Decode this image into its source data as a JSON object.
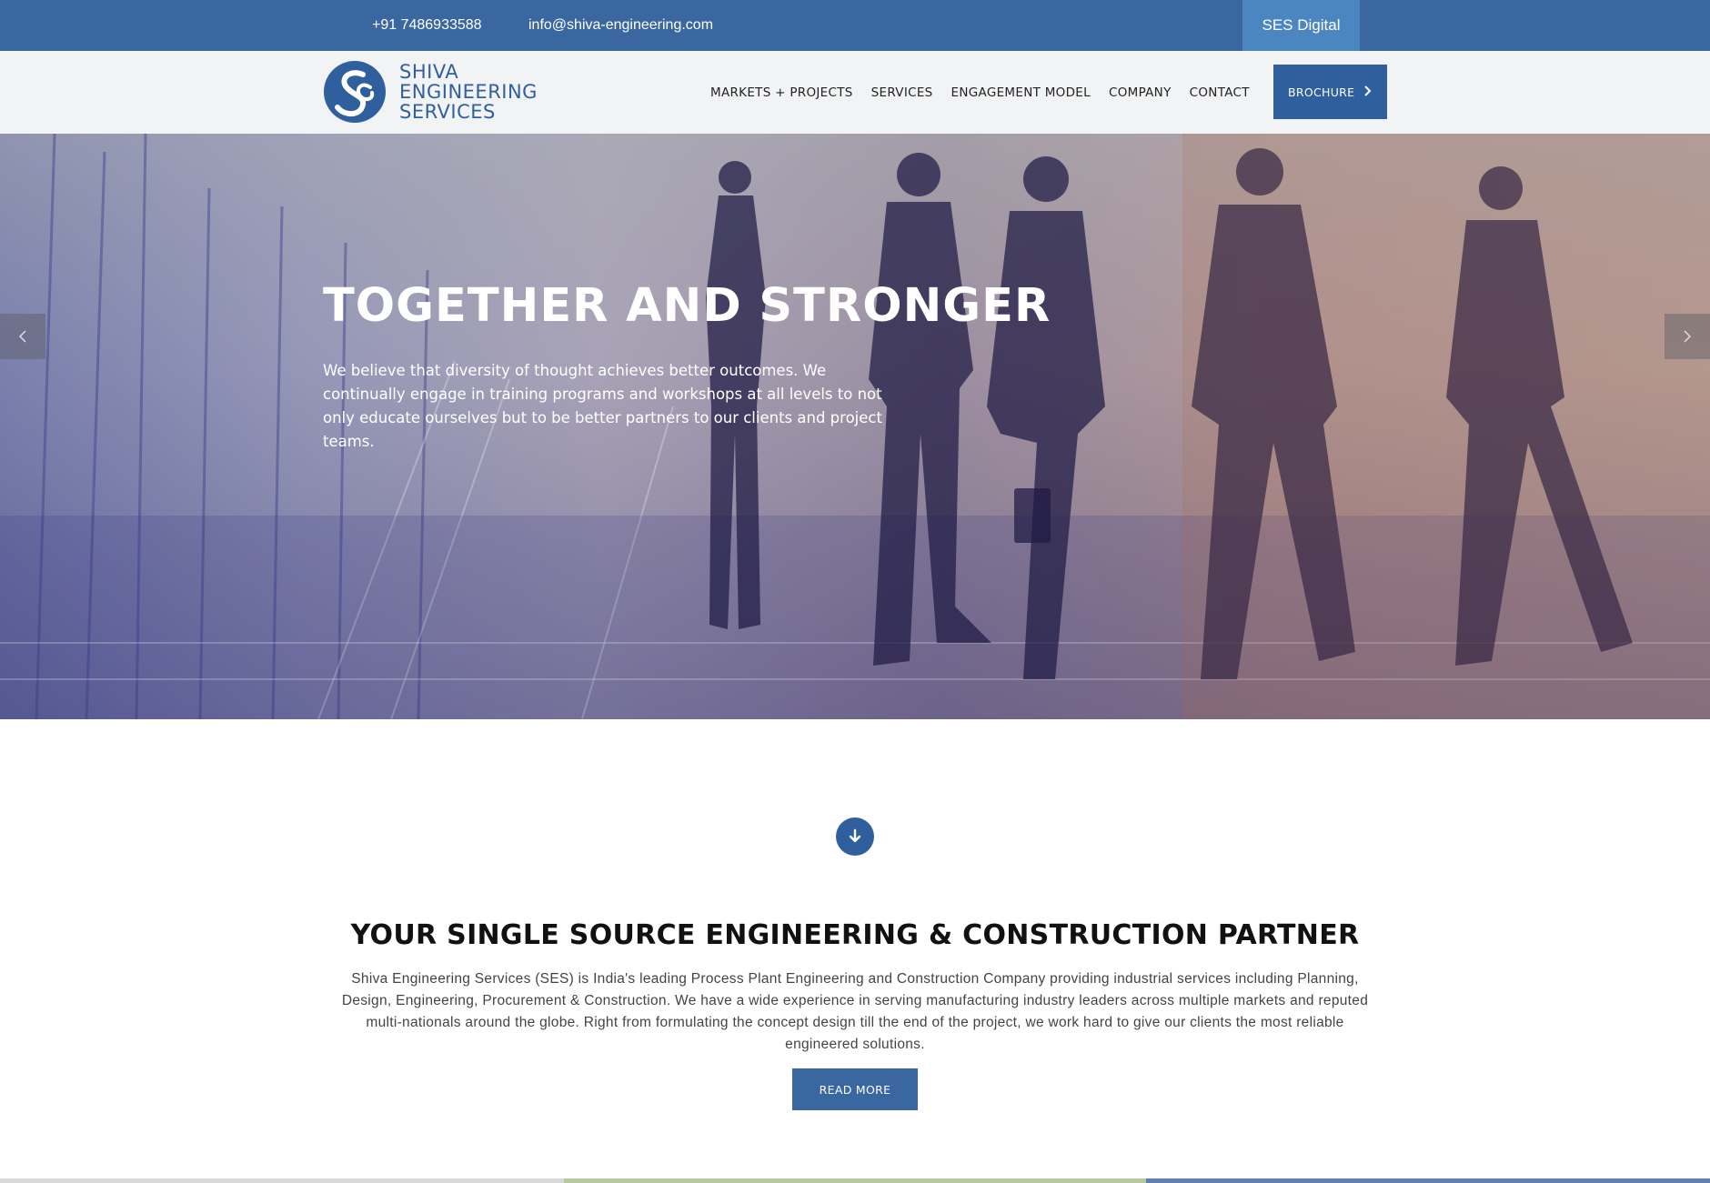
{
  "topbar": {
    "phone": "+91 7486933588",
    "email": "info@shiva-engineering.com",
    "digital_label": "SES Digital"
  },
  "brand": {
    "line1": "SHIVA",
    "line2": "ENGINEERING",
    "line3": "SERVICES"
  },
  "nav": {
    "items": [
      {
        "label": "MARKETS + PROJECTS"
      },
      {
        "label": "SERVICES"
      },
      {
        "label": "ENGAGEMENT MODEL"
      },
      {
        "label": "COMPANY"
      },
      {
        "label": "CONTACT"
      }
    ],
    "brochure_label": "BROCHURE"
  },
  "hero": {
    "title": "TOGETHER AND STRONGER",
    "text": "We believe that diversity of thought achieves better outcomes. We continually engage in training programs and workshops at all levels to not only educate ourselves but to be better partners to our clients and project teams."
  },
  "intro": {
    "title": "YOUR SINGLE SOURCE ENGINEERING & CONSTRUCTION PARTNER",
    "text": "Shiva Engineering Services (SES) is India's leading Process Plant Engineering and Construction Company providing industrial services including Planning, Design, Engineering, Procurement & Construction. We have a wide experience in serving manufacturing industry leaders across multiple markets and reputed multi-nationals around the globe. Right from formulating the concept design till the end of the project, we work hard to give our clients the most reliable engineered solutions.",
    "button_label": "READ MORE"
  },
  "colors": {
    "brand_blue": "#3a67a0",
    "accent_blue": "#4c86c1",
    "dark_blue": "#2f5f9c"
  }
}
